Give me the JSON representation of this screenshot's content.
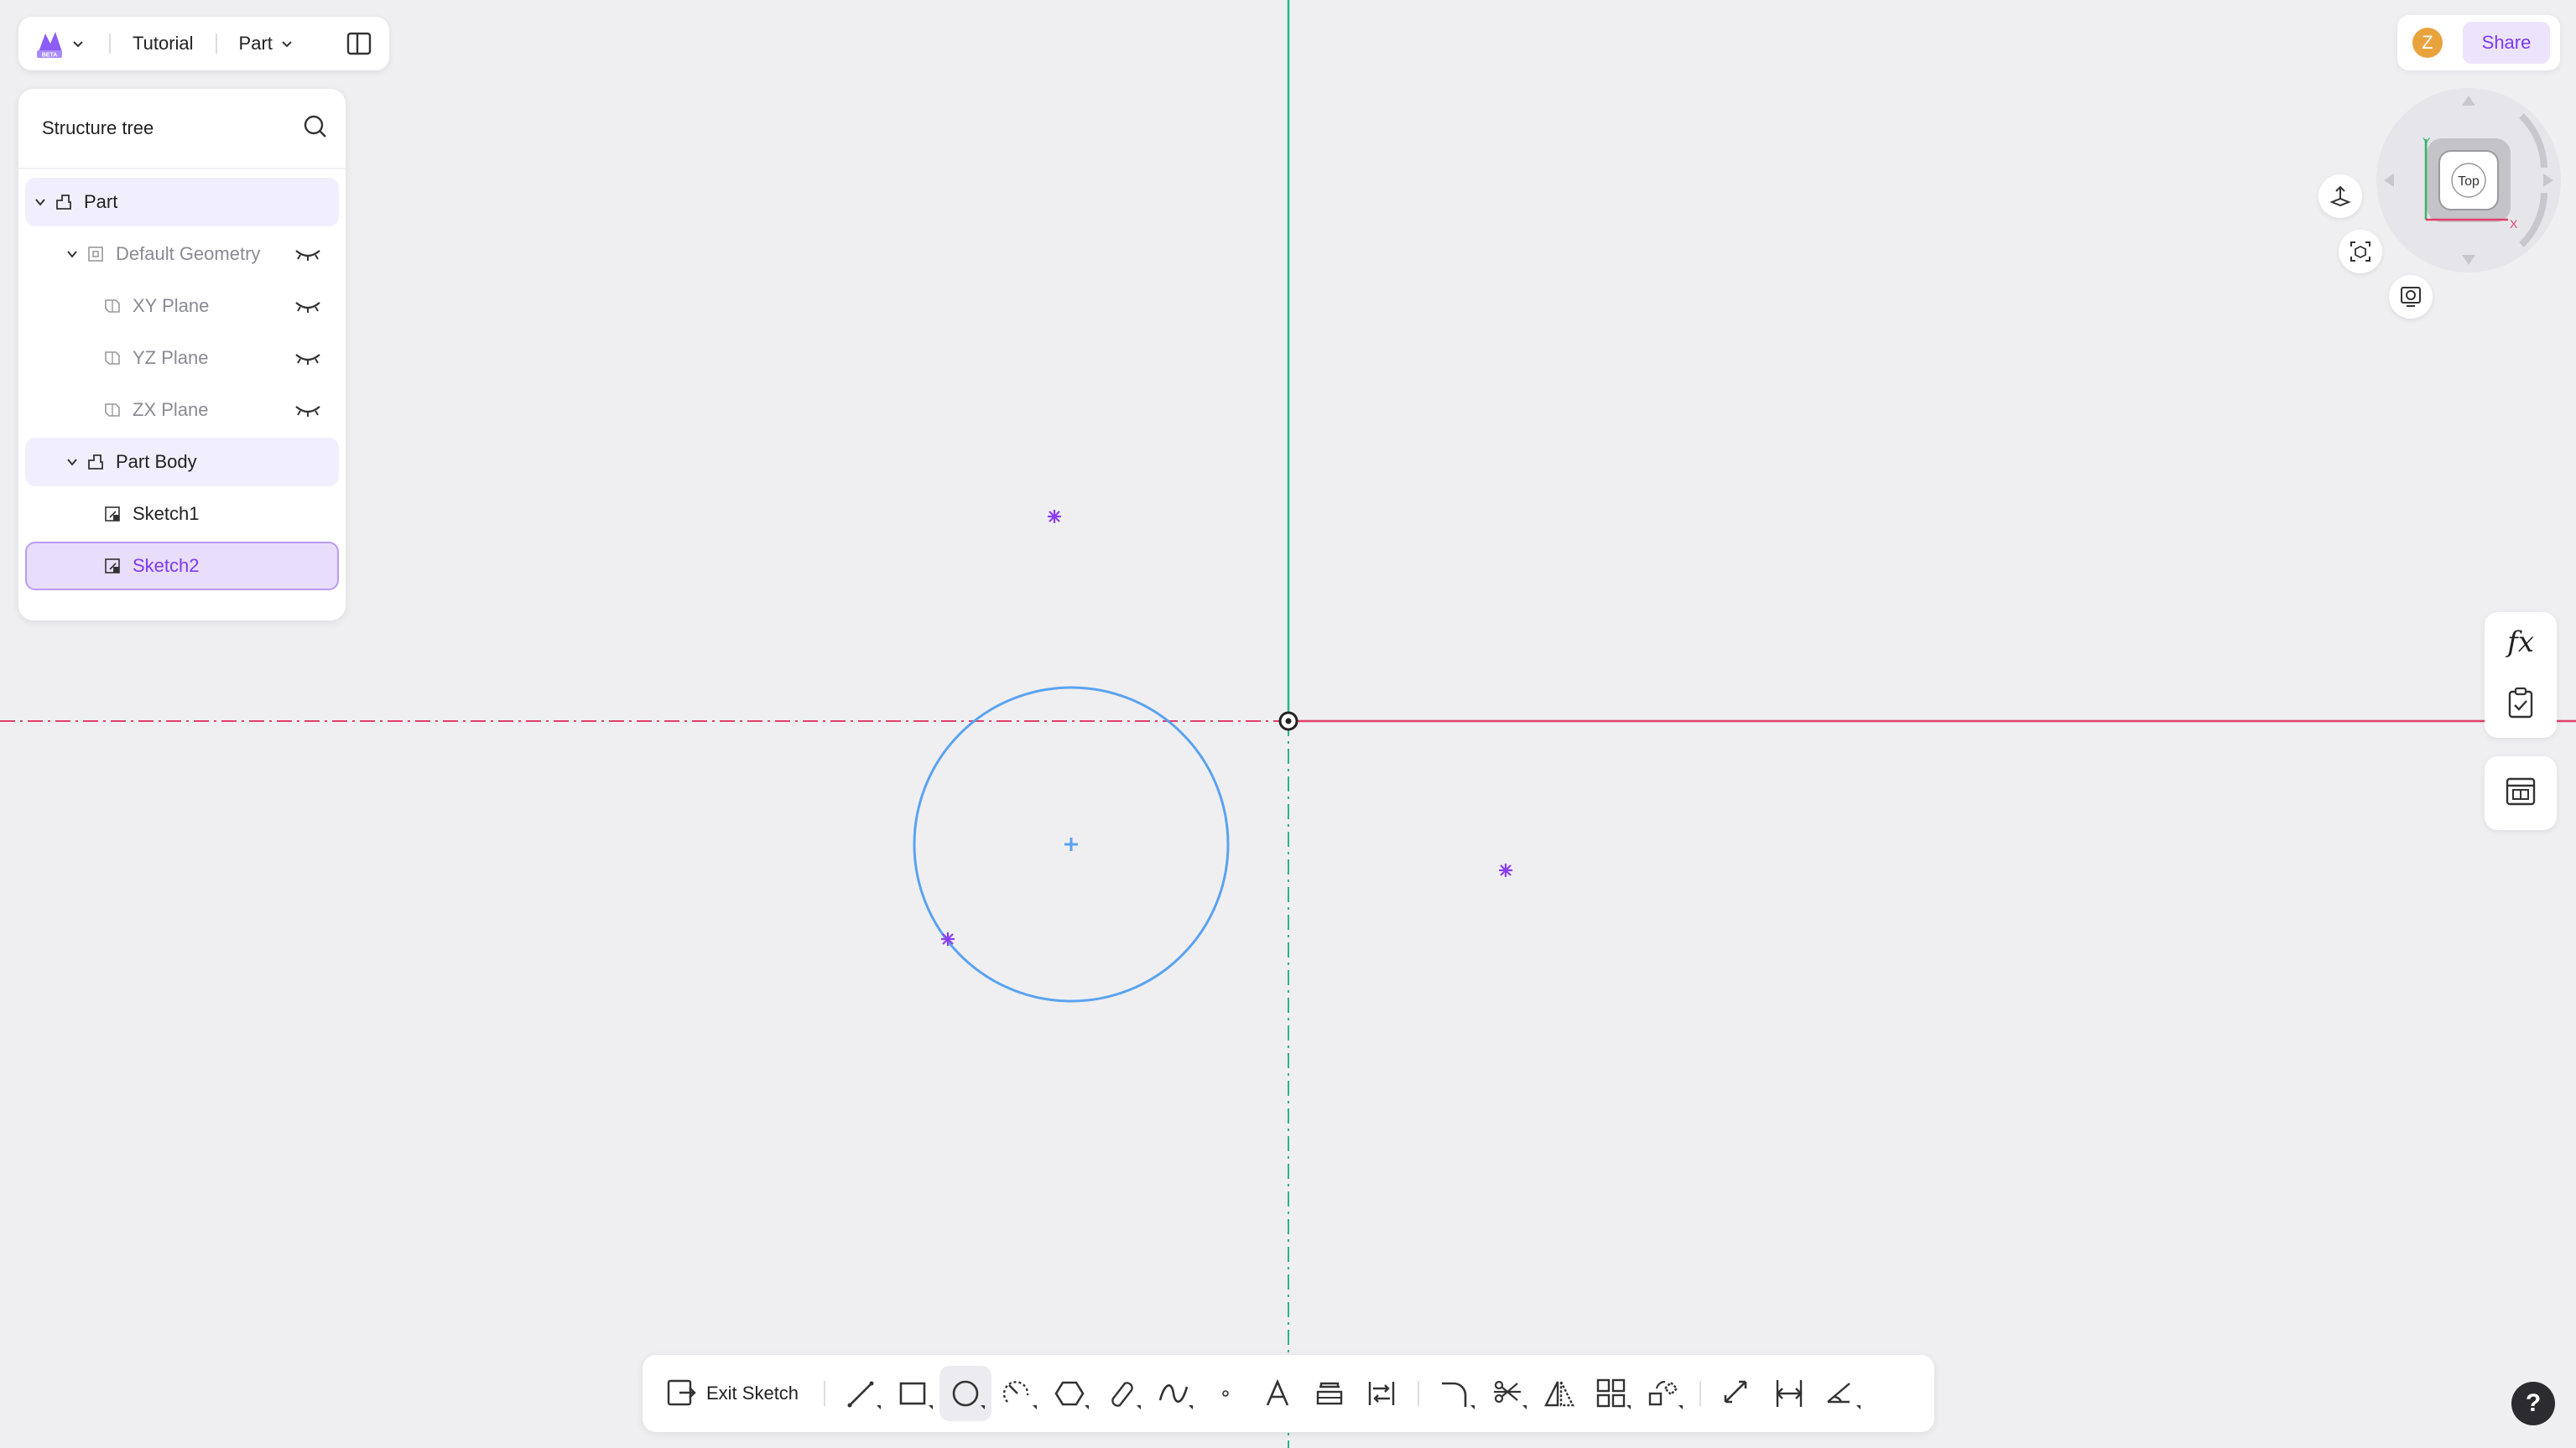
{
  "topbar": {
    "project": "Tutorial",
    "mode": "Part"
  },
  "tree": {
    "title": "Structure tree",
    "items": [
      {
        "label": "Part"
      },
      {
        "label": "Default Geometry"
      },
      {
        "label": "XY Plane"
      },
      {
        "label": "YZ Plane"
      },
      {
        "label": "ZX Plane"
      },
      {
        "label": "Part Body"
      },
      {
        "label": "Sketch1"
      },
      {
        "label": "Sketch2"
      }
    ]
  },
  "share": {
    "avatar_initial": "Z",
    "label": "Share"
  },
  "viewcube": {
    "face": "Top",
    "axis_x": "X",
    "axis_y": "Y"
  },
  "toolbar": {
    "exit_label": "Exit Sketch"
  },
  "help": "?",
  "colors": {
    "accent": "#7c3aed",
    "circle": "#5aa2f0",
    "x_axis": "#e0406a",
    "y_axis": "#2bb38a",
    "point": "#8b3cf0"
  }
}
